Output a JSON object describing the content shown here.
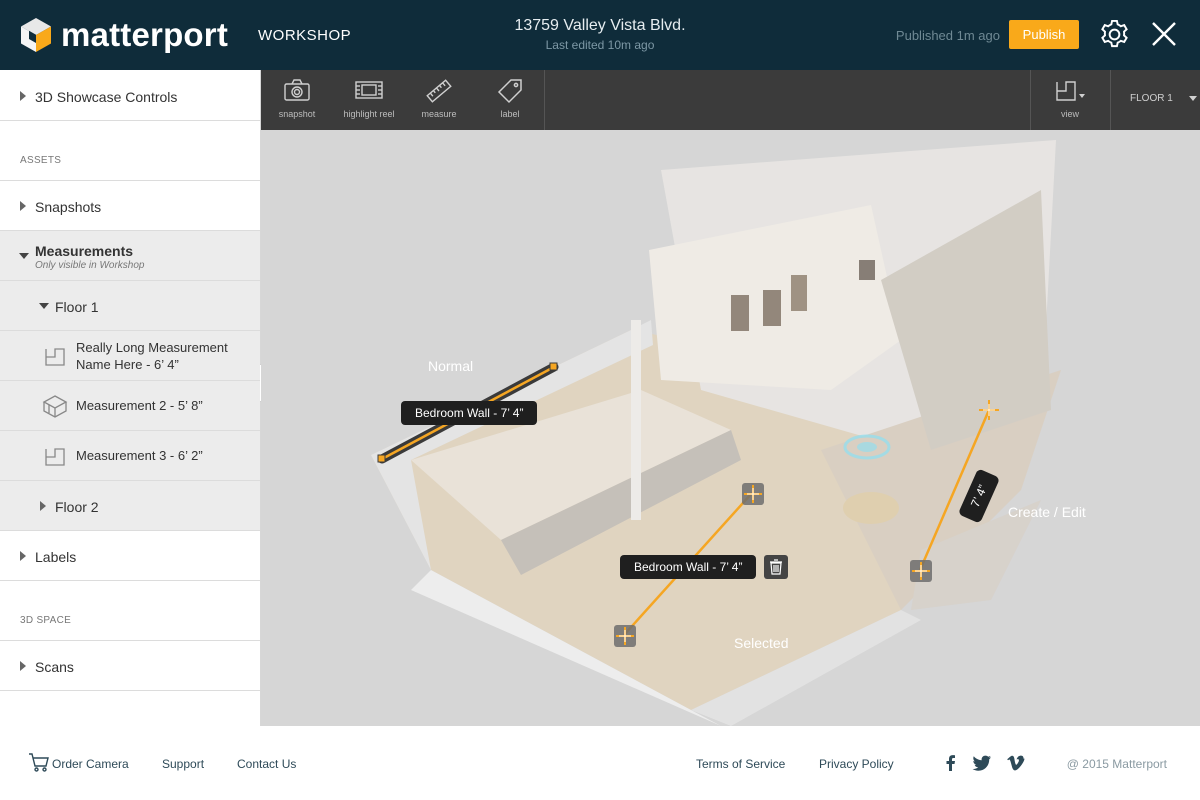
{
  "header": {
    "brand": "matterport",
    "section": "WORKSHOP",
    "address": "13759 Valley Vista Blvd.",
    "last_edited": "Last edited 10m ago",
    "published": "Published 1m ago",
    "publish_label": "Publish"
  },
  "sidebar": {
    "showcase_controls": "3D Showcase Controls",
    "assets_heading": "ASSETS",
    "snapshots": "Snapshots",
    "measurements": "Measurements",
    "measurements_note": "Only visible in Workshop",
    "floor1": "Floor 1",
    "items": [
      {
        "label_line1": "Really Long Measurement",
        "label_line2": "Name Here - 6’ 4”",
        "icon": "floorplan-icon"
      },
      {
        "label_line1": "Measurement 2 - 5’ 8”",
        "icon": "dollhouse-icon"
      },
      {
        "label_line1": "Measurement 3 - 6’ 2”",
        "icon": "floorplan-icon"
      }
    ],
    "floor2": "Floor 2",
    "labels": "Labels",
    "space_heading": "3D SPACE",
    "scans": "Scans"
  },
  "toolbar": {
    "tools": [
      {
        "label": "snapshot",
        "icon": "camera-icon"
      },
      {
        "label": "highlight reel",
        "icon": "film-icon"
      },
      {
        "label": "measure",
        "icon": "ruler-icon"
      },
      {
        "label": "label",
        "icon": "tag-icon"
      }
    ],
    "view_label": "view",
    "floor_label": "FLOOR 1"
  },
  "viewport": {
    "state_normal": "Normal",
    "state_selected": "Selected",
    "state_create": "Create / Edit",
    "measure_normal": "Bedroom  Wall - 7’ 4”",
    "measure_selected": "Bedroom  Wall - 7’ 4”",
    "measure_edit": "7’ 4”"
  },
  "footer": {
    "order_camera": "Order Camera",
    "support": "Support",
    "contact": "Contact Us",
    "terms": "Terms of Service",
    "privacy": "Privacy Policy",
    "copyright": "@ 2015 Matterport"
  },
  "colors": {
    "header_bg": "#0f2c3a",
    "accent": "#f9a91a",
    "toolbar_bg": "#3b3b3b"
  }
}
